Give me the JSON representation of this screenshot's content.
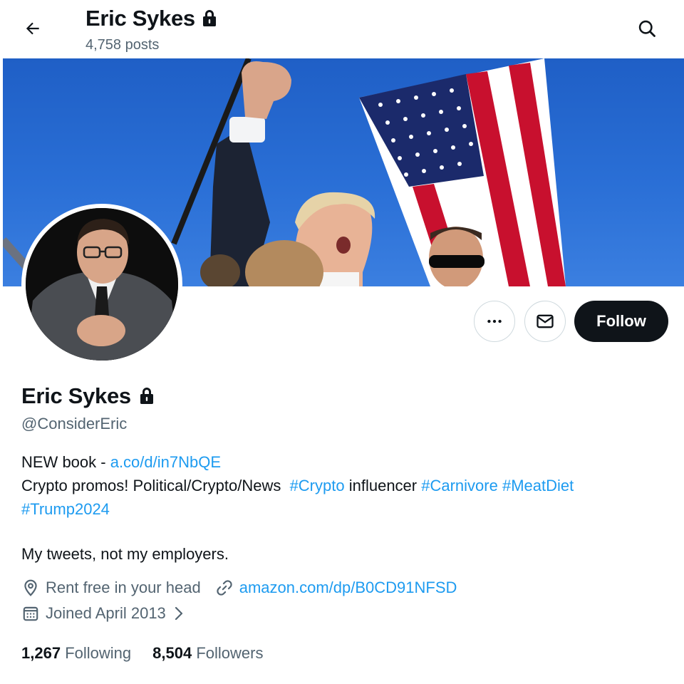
{
  "header": {
    "title": "Eric Sykes",
    "posts_count": "4,758 posts"
  },
  "icons": {
    "back": "arrow-left-icon",
    "search": "search-icon",
    "lock": "lock-icon",
    "more": "ellipsis-icon",
    "message": "envelope-icon",
    "location": "location-pin-icon",
    "link": "link-icon",
    "calendar": "calendar-icon",
    "chevron": "chevron-right-icon"
  },
  "actions": {
    "follow_label": "Follow"
  },
  "profile": {
    "name": "Eric Sykes",
    "handle": "@ConsiderEric",
    "bio": {
      "line1_prefix": "NEW book - ",
      "line1_link": "a.co/d/in7NbQE",
      "line2_text1": "Crypto promos! Political/Crypto/News  ",
      "hashtag_crypto": "#Crypto",
      "line2_text2": " influencer ",
      "hashtag_carnivore": "#Carnivore",
      "hashtag_meatdiet": "#MeatDiet",
      "hashtag_trump": "#Trump2024",
      "line4": "My tweets, not my employers."
    },
    "location": "Rent free in your head",
    "website": "amazon.com/dp/B0CD91NFSD",
    "joined": "Joined April 2013"
  },
  "stats": {
    "following_count": "1,267",
    "following_label": "Following",
    "followers_count": "8,504",
    "followers_label": "Followers"
  },
  "colors": {
    "link": "#1d9bf0",
    "text": "#0f1419",
    "secondary": "#536471",
    "border": "#cfd9de",
    "follow_bg": "#0f1419",
    "banner_sky": "#2a6fd6"
  }
}
